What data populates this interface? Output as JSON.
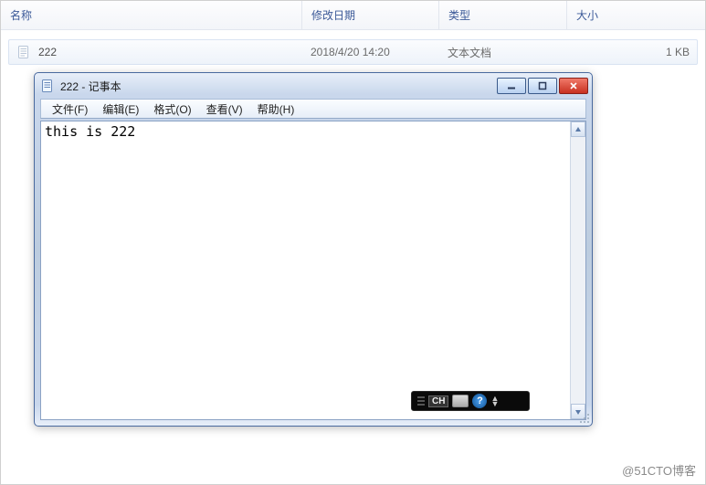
{
  "explorer": {
    "columns": {
      "name": "名称",
      "date": "修改日期",
      "type": "类型",
      "size": "大小"
    },
    "file": {
      "name": "222",
      "date": "2018/4/20 14:20",
      "type": "文本文档",
      "size": "1 KB"
    }
  },
  "notepad": {
    "title": "222 - 记事本",
    "menu": {
      "file": "文件(F)",
      "edit": "编辑(E)",
      "format": "格式(O)",
      "view": "查看(V)",
      "help": "帮助(H)"
    },
    "content": "this is 222"
  },
  "ime": {
    "lang": "CH",
    "help": "?"
  },
  "watermark": "@51CTO博客"
}
